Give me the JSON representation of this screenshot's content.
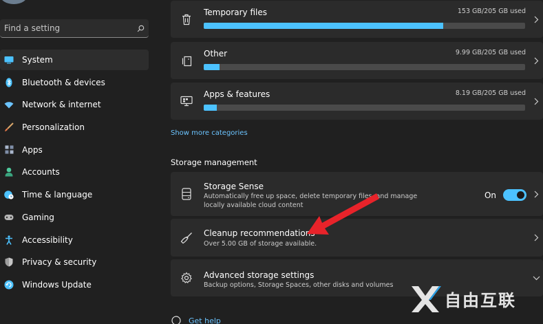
{
  "search": {
    "placeholder": "Find a setting"
  },
  "nav": [
    {
      "label": "System",
      "icon": "system-icon",
      "color": "#4cc2ff",
      "active": true
    },
    {
      "label": "Bluetooth & devices",
      "icon": "bluetooth-icon",
      "color": "#4cc2ff"
    },
    {
      "label": "Network & internet",
      "icon": "wifi-icon",
      "color": "#6cc4ff"
    },
    {
      "label": "Personalization",
      "icon": "brush-icon",
      "color": "#e89c5e"
    },
    {
      "label": "Apps",
      "icon": "apps-icon",
      "color": "#9aa8c0"
    },
    {
      "label": "Accounts",
      "icon": "person-icon",
      "color": "#4ec99c"
    },
    {
      "label": "Time & language",
      "icon": "globe-clock-icon",
      "color": "#4cc2ff"
    },
    {
      "label": "Gaming",
      "icon": "gamepad-icon",
      "color": "#b0b0b0"
    },
    {
      "label": "Accessibility",
      "icon": "accessibility-icon",
      "color": "#4cc2ff"
    },
    {
      "label": "Privacy & security",
      "icon": "shield-icon",
      "color": "#a0a0a0"
    },
    {
      "label": "Windows Update",
      "icon": "update-icon",
      "color": "#4cc2ff"
    }
  ],
  "storage": [
    {
      "name": "Temporary files",
      "used": "153 GB/205 GB used",
      "fraction": 0.746,
      "icon": "trash-icon"
    },
    {
      "name": "Other",
      "used": "9.99 GB/205 GB used",
      "fraction": 0.049,
      "icon": "file-icon"
    },
    {
      "name": "Apps & features",
      "used": "8.19 GB/205 GB used",
      "fraction": 0.04,
      "icon": "monitor-icon"
    }
  ],
  "show_more": "Show more categories",
  "section_title": "Storage management",
  "management": [
    {
      "title": "Storage Sense",
      "desc": "Automatically free up space, delete temporary files, and manage locally available cloud content",
      "toggle_label": "On",
      "toggle_on": true
    },
    {
      "title": "Cleanup recommendations",
      "desc": "Over 5.00 GB of storage available."
    },
    {
      "title": "Advanced storage settings",
      "desc": "Backup options, Storage Spaces, other disks and volumes"
    }
  ],
  "help": "Get help",
  "watermark": "自由互联",
  "colors": {
    "accent": "#4cc2ff",
    "arrow": "#e8232a"
  }
}
